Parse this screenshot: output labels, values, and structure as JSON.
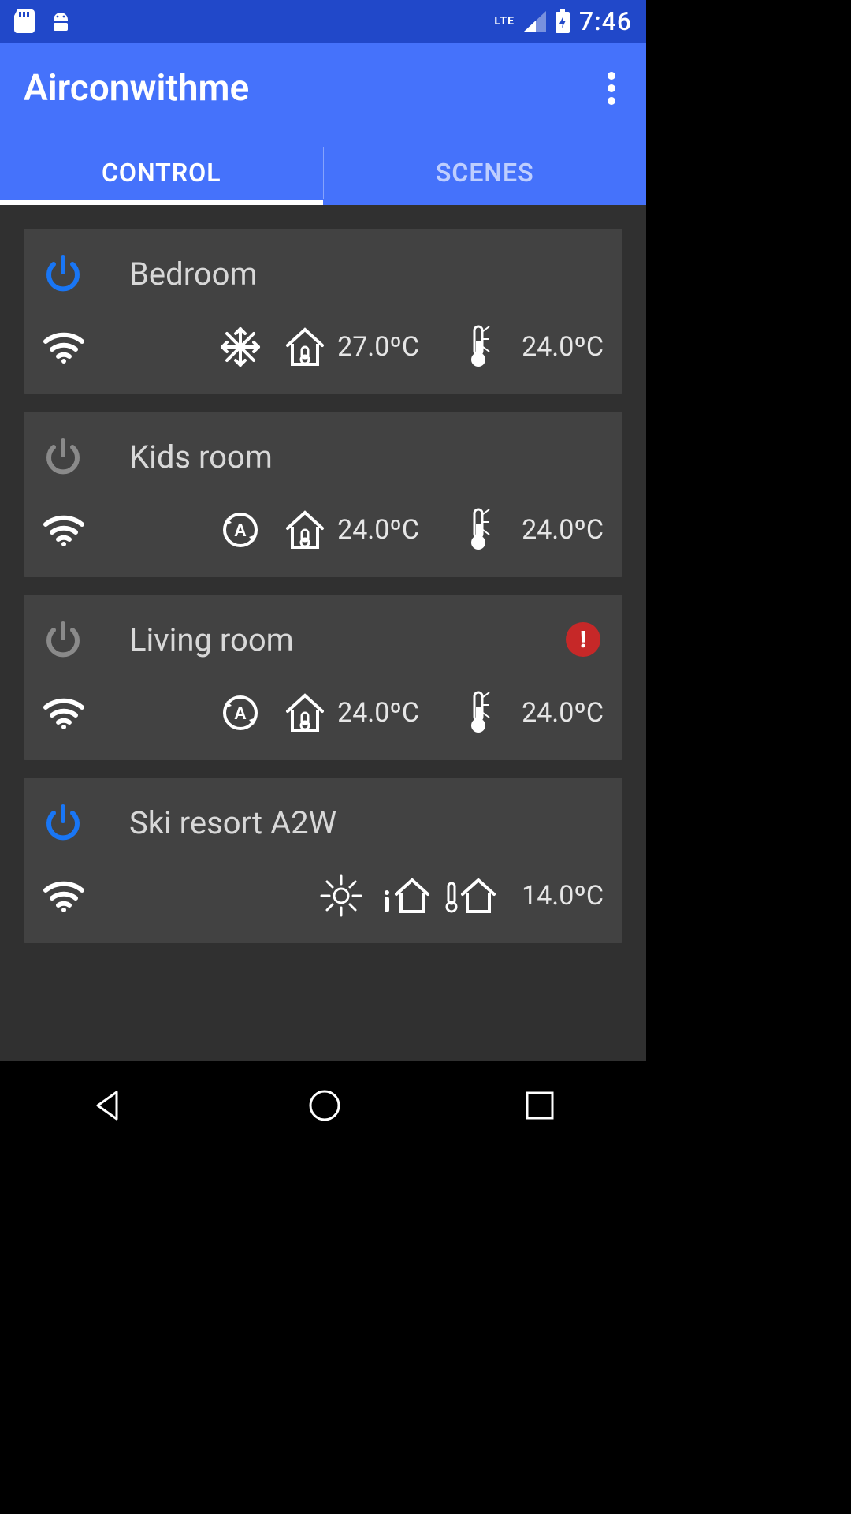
{
  "status": {
    "time": "7:46",
    "network": "LTE"
  },
  "header": {
    "title": "Airconwithme"
  },
  "tabs": {
    "control": "CONTROL",
    "scenes": "SCENES",
    "active": "control"
  },
  "rooms": [
    {
      "name": "Bedroom",
      "power_on": true,
      "mode": "cool",
      "house_temp": "27.0ºC",
      "set_temp": "24.0ºC",
      "alert": false,
      "variant": "standard"
    },
    {
      "name": "Kids room",
      "power_on": false,
      "mode": "auto",
      "house_temp": "24.0ºC",
      "set_temp": "24.0ºC",
      "alert": false,
      "variant": "standard"
    },
    {
      "name": "Living room",
      "power_on": false,
      "mode": "auto",
      "house_temp": "24.0ºC",
      "set_temp": "24.0ºC",
      "alert": true,
      "variant": "standard"
    },
    {
      "name": "Ski resort A2W",
      "power_on": true,
      "mode": "heat",
      "house_temp": "",
      "set_temp": "14.0ºC",
      "alert": false,
      "variant": "a2w"
    }
  ],
  "colors": {
    "accent": "#4572FB",
    "accent_dark": "#2148c9",
    "power_on": "#1976f5",
    "power_off": "#8a8a8a",
    "alert": "#c62828",
    "card": "#424242",
    "bg": "#303030"
  }
}
